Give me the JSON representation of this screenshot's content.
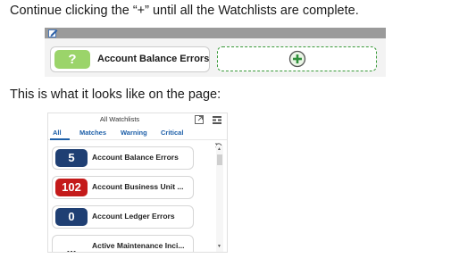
{
  "instructions": {
    "line1": "Continue clicking the “+” until all the Watchlists are complete.",
    "line2": "This is what it looks like on the page:"
  },
  "top_panel": {
    "tile": {
      "badge": "?",
      "label": "Account Balance Errors",
      "badge_color": "#9bd46a"
    },
    "add_tile_border_color": "#3a9a3a"
  },
  "watchlists": {
    "title": "All Watchlists",
    "tabs": {
      "all": "All",
      "matches": "Matches",
      "warning": "Warning",
      "critical": "Critical"
    },
    "items": [
      {
        "badge": "5",
        "label": "Account Balance Errors",
        "color": "#1f3f73"
      },
      {
        "badge": "102",
        "label": "Account Business Unit ...",
        "color": "#c41a1a"
      },
      {
        "badge": "0",
        "label": "Account Ledger Errors",
        "color": "#1f3f73"
      },
      {
        "badge": "...",
        "label": "Active Maintenance Inci...",
        "color": ""
      }
    ]
  }
}
